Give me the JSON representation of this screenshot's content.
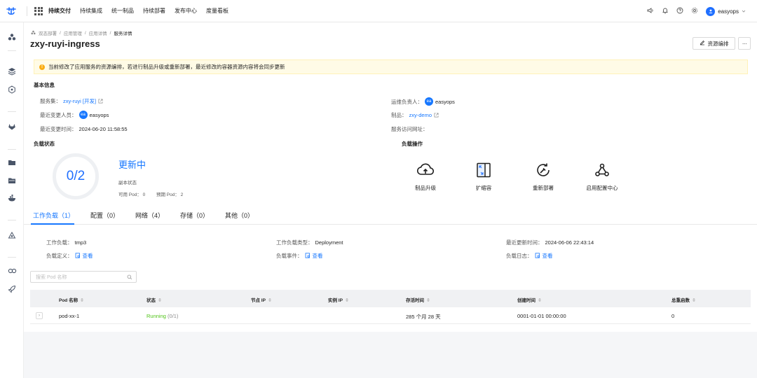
{
  "topbar": {
    "nav": [
      "持续交付",
      "持续集成",
      "统一制品",
      "持续部署",
      "发布中心",
      "度量看板"
    ],
    "user": "easyops"
  },
  "breadcrumb": [
    "双态部署",
    "应用管理",
    "应用详情",
    "服务详情"
  ],
  "page": {
    "title": "zxy-ruyi-ingress",
    "edit_label": "资源编排",
    "more_label": "···"
  },
  "alert": "当前修改了应用服务的资源编排，若进行制品升级或重新部署，最近修改的容器资源内容将会同步更新",
  "basic": {
    "heading": "基本信息",
    "service_set_label": "服务集：",
    "service_set_value": "zxy-ruyi [开发]",
    "last_changer_label": "最近变更人员：",
    "last_changer_avatar": "ea",
    "last_changer_value": "easyops",
    "last_change_time_label": "最近变更时间：",
    "last_change_time_value": "2024-06-20 11:58:55",
    "ops_owner_label": "运维负责人：",
    "ops_owner_avatar": "ea",
    "ops_owner_value": "easyops",
    "artifact_label": "制品：",
    "artifact_value": "zxy-demo",
    "access_url_label": "服务访问网址："
  },
  "load_status": {
    "heading": "负载状态",
    "ratio": "0/2",
    "state": "更新中",
    "replica_label": "副本状态",
    "available": "可用 Pod： 0",
    "expected": "预期 Pod： 2"
  },
  "load_ops": {
    "heading": "负载操作",
    "items": [
      "制品升级",
      "扩缩容",
      "重新部署",
      "启用配置中心"
    ]
  },
  "tabs": [
    "工作负载（1）",
    "配置（0）",
    "网络（4）",
    "存储（0）",
    "其他（0）"
  ],
  "workload": {
    "name_label": "工作负载：",
    "name_value": "tmp3",
    "type_label": "工作负载类型：",
    "type_value": "Deployment",
    "updated_label": "最近更新时间：",
    "updated_value": "2024-06-06 22:43:14",
    "def_label": "负载定义：",
    "events_label": "负载事件：",
    "logs_label": "负载日志：",
    "view": "查看"
  },
  "search": {
    "placeholder": "搜索 Pod 名称"
  },
  "table": {
    "headers": [
      "Pod 名称",
      "状态",
      "节点 IP",
      "实例 IP",
      "存活时间",
      "创建时间",
      "总重启数"
    ],
    "rows": [
      {
        "name": "pod-xx-1",
        "status": "Running",
        "status_count": " (0/1)",
        "node_ip": "",
        "instance_ip": "",
        "age": "285 个月 28 天",
        "created": "0001-01-01 00:00:00",
        "restarts": "0"
      }
    ]
  },
  "colors": {
    "accent": "#1677ff",
    "running": "#52c41a",
    "warning": "#faad14"
  }
}
